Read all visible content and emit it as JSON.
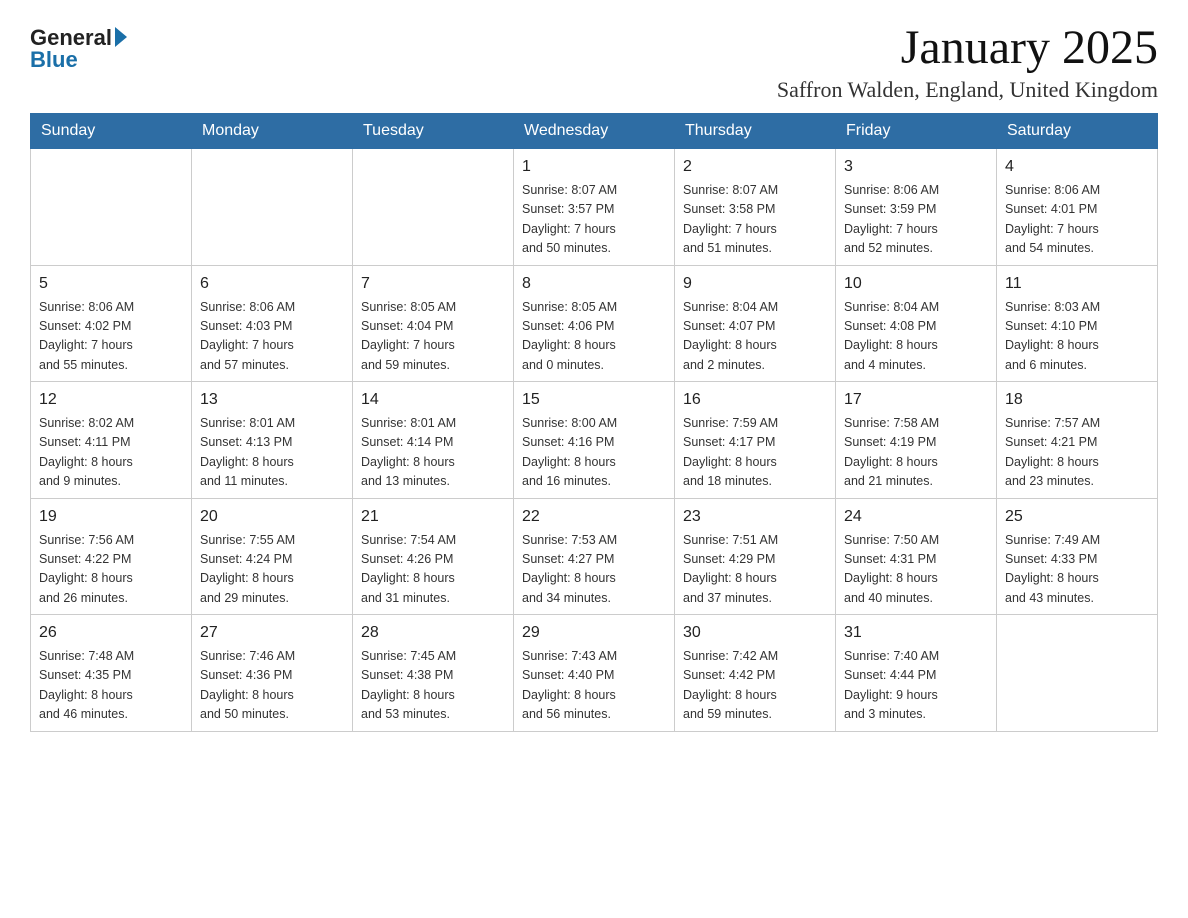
{
  "header": {
    "logo_general": "General",
    "logo_blue": "Blue",
    "month_title": "January 2025",
    "location": "Saffron Walden, England, United Kingdom"
  },
  "days_of_week": [
    "Sunday",
    "Monday",
    "Tuesday",
    "Wednesday",
    "Thursday",
    "Friday",
    "Saturday"
  ],
  "weeks": [
    [
      {
        "day": "",
        "info": ""
      },
      {
        "day": "",
        "info": ""
      },
      {
        "day": "",
        "info": ""
      },
      {
        "day": "1",
        "info": "Sunrise: 8:07 AM\nSunset: 3:57 PM\nDaylight: 7 hours\nand 50 minutes."
      },
      {
        "day": "2",
        "info": "Sunrise: 8:07 AM\nSunset: 3:58 PM\nDaylight: 7 hours\nand 51 minutes."
      },
      {
        "day": "3",
        "info": "Sunrise: 8:06 AM\nSunset: 3:59 PM\nDaylight: 7 hours\nand 52 minutes."
      },
      {
        "day": "4",
        "info": "Sunrise: 8:06 AM\nSunset: 4:01 PM\nDaylight: 7 hours\nand 54 minutes."
      }
    ],
    [
      {
        "day": "5",
        "info": "Sunrise: 8:06 AM\nSunset: 4:02 PM\nDaylight: 7 hours\nand 55 minutes."
      },
      {
        "day": "6",
        "info": "Sunrise: 8:06 AM\nSunset: 4:03 PM\nDaylight: 7 hours\nand 57 minutes."
      },
      {
        "day": "7",
        "info": "Sunrise: 8:05 AM\nSunset: 4:04 PM\nDaylight: 7 hours\nand 59 minutes."
      },
      {
        "day": "8",
        "info": "Sunrise: 8:05 AM\nSunset: 4:06 PM\nDaylight: 8 hours\nand 0 minutes."
      },
      {
        "day": "9",
        "info": "Sunrise: 8:04 AM\nSunset: 4:07 PM\nDaylight: 8 hours\nand 2 minutes."
      },
      {
        "day": "10",
        "info": "Sunrise: 8:04 AM\nSunset: 4:08 PM\nDaylight: 8 hours\nand 4 minutes."
      },
      {
        "day": "11",
        "info": "Sunrise: 8:03 AM\nSunset: 4:10 PM\nDaylight: 8 hours\nand 6 minutes."
      }
    ],
    [
      {
        "day": "12",
        "info": "Sunrise: 8:02 AM\nSunset: 4:11 PM\nDaylight: 8 hours\nand 9 minutes."
      },
      {
        "day": "13",
        "info": "Sunrise: 8:01 AM\nSunset: 4:13 PM\nDaylight: 8 hours\nand 11 minutes."
      },
      {
        "day": "14",
        "info": "Sunrise: 8:01 AM\nSunset: 4:14 PM\nDaylight: 8 hours\nand 13 minutes."
      },
      {
        "day": "15",
        "info": "Sunrise: 8:00 AM\nSunset: 4:16 PM\nDaylight: 8 hours\nand 16 minutes."
      },
      {
        "day": "16",
        "info": "Sunrise: 7:59 AM\nSunset: 4:17 PM\nDaylight: 8 hours\nand 18 minutes."
      },
      {
        "day": "17",
        "info": "Sunrise: 7:58 AM\nSunset: 4:19 PM\nDaylight: 8 hours\nand 21 minutes."
      },
      {
        "day": "18",
        "info": "Sunrise: 7:57 AM\nSunset: 4:21 PM\nDaylight: 8 hours\nand 23 minutes."
      }
    ],
    [
      {
        "day": "19",
        "info": "Sunrise: 7:56 AM\nSunset: 4:22 PM\nDaylight: 8 hours\nand 26 minutes."
      },
      {
        "day": "20",
        "info": "Sunrise: 7:55 AM\nSunset: 4:24 PM\nDaylight: 8 hours\nand 29 minutes."
      },
      {
        "day": "21",
        "info": "Sunrise: 7:54 AM\nSunset: 4:26 PM\nDaylight: 8 hours\nand 31 minutes."
      },
      {
        "day": "22",
        "info": "Sunrise: 7:53 AM\nSunset: 4:27 PM\nDaylight: 8 hours\nand 34 minutes."
      },
      {
        "day": "23",
        "info": "Sunrise: 7:51 AM\nSunset: 4:29 PM\nDaylight: 8 hours\nand 37 minutes."
      },
      {
        "day": "24",
        "info": "Sunrise: 7:50 AM\nSunset: 4:31 PM\nDaylight: 8 hours\nand 40 minutes."
      },
      {
        "day": "25",
        "info": "Sunrise: 7:49 AM\nSunset: 4:33 PM\nDaylight: 8 hours\nand 43 minutes."
      }
    ],
    [
      {
        "day": "26",
        "info": "Sunrise: 7:48 AM\nSunset: 4:35 PM\nDaylight: 8 hours\nand 46 minutes."
      },
      {
        "day": "27",
        "info": "Sunrise: 7:46 AM\nSunset: 4:36 PM\nDaylight: 8 hours\nand 50 minutes."
      },
      {
        "day": "28",
        "info": "Sunrise: 7:45 AM\nSunset: 4:38 PM\nDaylight: 8 hours\nand 53 minutes."
      },
      {
        "day": "29",
        "info": "Sunrise: 7:43 AM\nSunset: 4:40 PM\nDaylight: 8 hours\nand 56 minutes."
      },
      {
        "day": "30",
        "info": "Sunrise: 7:42 AM\nSunset: 4:42 PM\nDaylight: 8 hours\nand 59 minutes."
      },
      {
        "day": "31",
        "info": "Sunrise: 7:40 AM\nSunset: 4:44 PM\nDaylight: 9 hours\nand 3 minutes."
      },
      {
        "day": "",
        "info": ""
      }
    ]
  ]
}
